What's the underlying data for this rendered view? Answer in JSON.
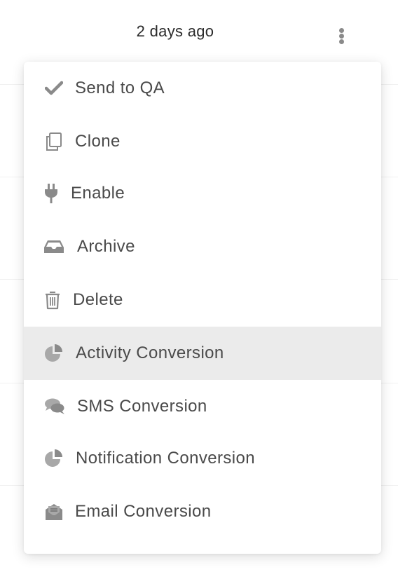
{
  "header": {
    "timestamp": "2 days ago",
    "more_icon": "kebab-vertical-icon"
  },
  "menu": {
    "active_index": 5,
    "items": [
      {
        "label": "Send to QA",
        "icon": "checkmark-icon"
      },
      {
        "label": "Clone",
        "icon": "copy-icon"
      },
      {
        "label": "Enable",
        "icon": "plug-icon"
      },
      {
        "label": "Archive",
        "icon": "inbox-icon"
      },
      {
        "label": "Delete",
        "icon": "trash-icon"
      },
      {
        "label": "Activity Conversion",
        "icon": "pie-chart-icon"
      },
      {
        "label": "SMS Conversion",
        "icon": "chat-bubbles-icon"
      },
      {
        "label": "Notification Conversion",
        "icon": "pie-chart-icon"
      },
      {
        "label": "Email Conversion",
        "icon": "envelope-open-icon"
      }
    ]
  },
  "colors": {
    "icon": "#8a8a8a",
    "text": "#4a4a4a",
    "active_bg": "#ebebeb"
  }
}
